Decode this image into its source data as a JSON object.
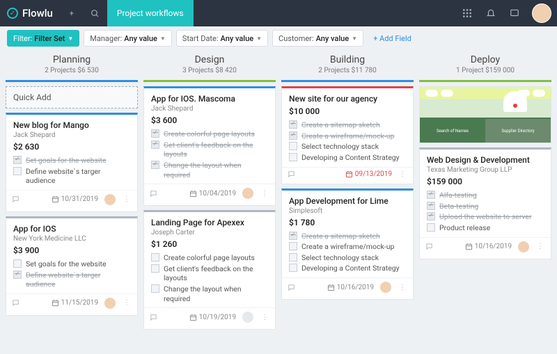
{
  "app": {
    "name": "Flowlu",
    "tab": "Project workflows"
  },
  "filters": {
    "set": {
      "label": "Filter:",
      "value": "Filter Set"
    },
    "items": [
      {
        "label": "Manager:",
        "value": "Any value"
      },
      {
        "label": "Start Date:",
        "value": "Any value"
      },
      {
        "label": "Customer:",
        "value": "Any value"
      }
    ],
    "add_field": "+ Add Field"
  },
  "columns": [
    {
      "title": "Planning",
      "sub": "2 Projects   $6 530",
      "bar": "c-blue",
      "quick_add": "Quick Add",
      "cards": [
        {
          "bar": "c-blue",
          "title": "New blog for Mango",
          "sub": "Jack Shepard",
          "price": "$2 630",
          "tasks": [
            {
              "t": "Set goals for the website",
              "d": true
            },
            {
              "t": "Define website`s targer audience",
              "d": false
            }
          ],
          "date": "10/31/2019",
          "avatar": true
        },
        {
          "bar": "c-gray",
          "title": "App for IOS",
          "sub": "New York Medicine LLC",
          "price": "$3 900",
          "tasks": [
            {
              "t": "Set goals for the website",
              "d": false
            },
            {
              "t": "Define website`s targer audience",
              "d": true
            }
          ],
          "date": "11/15/2019",
          "avatar": true
        }
      ]
    },
    {
      "title": "Design",
      "sub": "3 Projects   $8 420",
      "bar": "c-green",
      "cards": [
        {
          "bar": "c-blue",
          "title": "App for IOS. Mascoma",
          "sub": "Jack Shepard",
          "price": "$3 600",
          "tasks": [
            {
              "t": "Create colorful page layouts",
              "d": true
            },
            {
              "t": "Get client's feedback on the layouts",
              "d": true
            },
            {
              "t": "Change the layout when required",
              "d": true
            }
          ],
          "date": "10/04/2019",
          "avatar": true
        },
        {
          "bar": "c-gray",
          "title": "Landing Page for Apexex",
          "sub": "Joseph Carter",
          "price": "$1 260",
          "tasks": [
            {
              "t": "Create colorful page layouts",
              "d": false
            },
            {
              "t": "Get client's feedback on the layouts",
              "d": false
            },
            {
              "t": "Change the layout when required",
              "d": false
            }
          ],
          "date": "10/19/2019",
          "avatar": false,
          "grayavatar": true
        }
      ]
    },
    {
      "title": "Building",
      "sub": "2 Projects   $11 780",
      "bar": "c-blue",
      "cards": [
        {
          "bar": "c-red",
          "title": "New site for our agency",
          "sub": "",
          "price": "$10 000",
          "tasks": [
            {
              "t": "Create a sitemap sketch",
              "d": true
            },
            {
              "t": "Create a wireframe/mock-up",
              "d": true
            },
            {
              "t": "Select technology stack",
              "d": false
            },
            {
              "t": "Developing a Content Strategy",
              "d": false
            }
          ],
          "date": "09/13/2019",
          "date_red": true
        },
        {
          "bar": "c-blue",
          "title": "App Development for Lime",
          "sub": "Simplesoft",
          "price": "$1 780",
          "tasks": [
            {
              "t": "Create a sitemap sketch",
              "d": true
            },
            {
              "t": "Create a wireframe/mock-up",
              "d": false
            },
            {
              "t": "Select technology stack",
              "d": false
            },
            {
              "t": "Developing a Content Strategy",
              "d": false
            }
          ],
          "date": "10/16/2019",
          "avatar": true
        }
      ]
    },
    {
      "title": "Deploy",
      "sub": "1 Project   $159 000",
      "bar": "c-green",
      "thumb": true,
      "cards": [
        {
          "bar": "c-gray",
          "title": "Web Design & Development",
          "sub": "Texas Marketing Group LLP",
          "price": "$159 000",
          "tasks": [
            {
              "t": "Alfa-testing",
              "d": true
            },
            {
              "t": "Beta-testing",
              "d": true
            },
            {
              "t": "Upload the website to server",
              "d": true
            },
            {
              "t": "Product release",
              "d": false
            }
          ],
          "date": "10/16/2019",
          "avatar": true
        }
      ]
    }
  ]
}
